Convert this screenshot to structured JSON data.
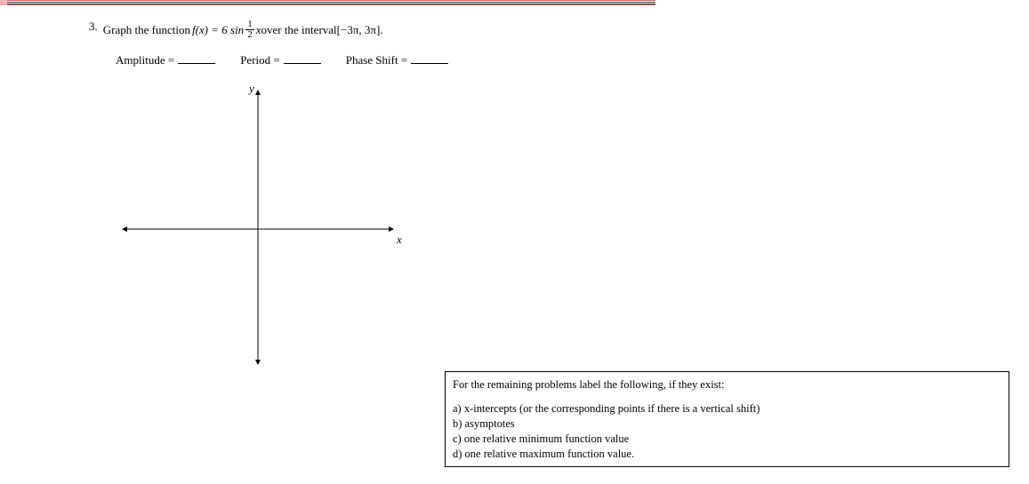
{
  "problem": {
    "number": "3.",
    "pre_text": "Graph the function ",
    "func_lhs": "f(x) = 6 sin",
    "frac_num": "1",
    "frac_den": "2",
    "post_frac": "x",
    "over_text": " over the interval ",
    "interval": "[−3π, 3π].",
    "amplitude_label": "Amplitude =",
    "period_label": "Period =",
    "phase_label": "Phase Shift ="
  },
  "axes": {
    "y_label": "y",
    "x_label": "x"
  },
  "instructions": {
    "heading": "For the remaining problems label the following, if they exist:",
    "item_a": "a) x-intercepts (or the corresponding points if there is a vertical shift)",
    "item_b": "b) asymptotes",
    "item_c": "c) one relative minimum function value",
    "item_d": "d) one relative maximum function value."
  }
}
